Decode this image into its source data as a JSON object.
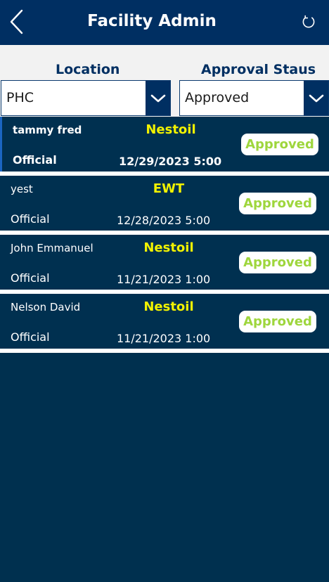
{
  "header": {
    "title": "Facility Admin",
    "back_icon": "chevron-left-icon",
    "refresh_icon": "refresh-icon"
  },
  "filters": {
    "location_label": "Location",
    "location_value": "PHC",
    "status_label": "Approval Staus",
    "status_value": "Approved"
  },
  "colors": {
    "header_bg": "#002f62",
    "list_bg": "#003050",
    "company_text": "#f2f200",
    "badge_text": "#9ed63d"
  },
  "records": [
    {
      "name": "tammy fred",
      "type": "Official",
      "company": "Nestoil",
      "datetime": "12/29/2023 5:00",
      "status": "Approved"
    },
    {
      "name": "yest",
      "type": "Official",
      "company": "EWT",
      "datetime": "12/28/2023 5:00",
      "status": "Approved"
    },
    {
      "name": "John Emmanuel",
      "type": "Official",
      "company": "Nestoil",
      "datetime": "11/21/2023 1:00",
      "status": "Approved"
    },
    {
      "name": "Nelson David",
      "type": "Official",
      "company": "Nestoil",
      "datetime": "11/21/2023 1:00",
      "status": "Approved"
    }
  ]
}
